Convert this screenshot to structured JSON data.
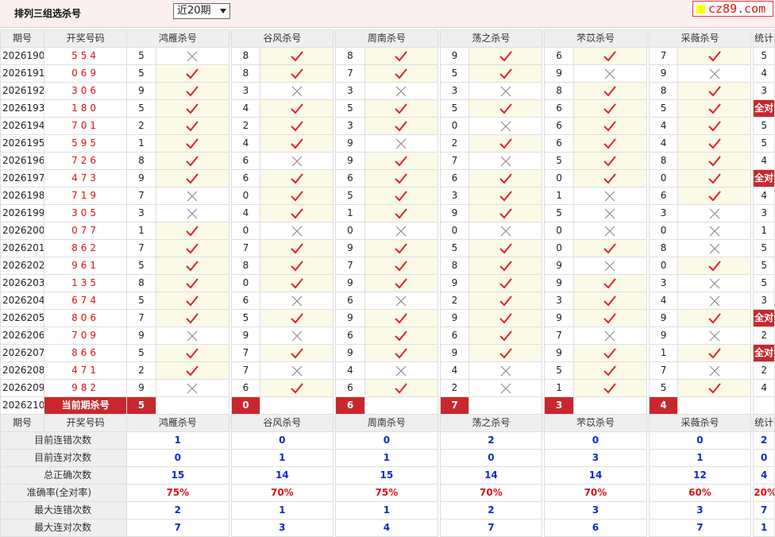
{
  "page": {
    "title": "排列三组选杀号",
    "period": "近20期",
    "site": "cz89.com"
  },
  "headers": [
    "期号",
    "开奖号码",
    "鸿雁杀号",
    "谷风杀号",
    "周南杀号",
    "荡之杀号",
    "芣苡杀号",
    "采薇杀号",
    "统计"
  ],
  "rows": [
    {
      "issue": "2026190",
      "num": "554",
      "k": [
        [
          5,
          0
        ],
        [
          8,
          1
        ],
        [
          8,
          1
        ],
        [
          9,
          1
        ],
        [
          6,
          1
        ],
        [
          7,
          1
        ]
      ],
      "cnt": "5"
    },
    {
      "issue": "2026191",
      "num": "069",
      "k": [
        [
          5,
          1
        ],
        [
          8,
          1
        ],
        [
          7,
          1
        ],
        [
          5,
          1
        ],
        [
          9,
          0
        ],
        [
          9,
          0
        ]
      ],
      "cnt": "4"
    },
    {
      "issue": "2026192",
      "num": "306",
      "k": [
        [
          9,
          1
        ],
        [
          3,
          0
        ],
        [
          3,
          0
        ],
        [
          3,
          0
        ],
        [
          8,
          1
        ],
        [
          8,
          1
        ]
      ],
      "cnt": "3"
    },
    {
      "issue": "2026193",
      "num": "180",
      "k": [
        [
          5,
          1
        ],
        [
          4,
          1
        ],
        [
          5,
          1
        ],
        [
          5,
          1
        ],
        [
          6,
          1
        ],
        [
          5,
          1
        ]
      ],
      "cnt": "全对"
    },
    {
      "issue": "2026194",
      "num": "701",
      "k": [
        [
          2,
          1
        ],
        [
          2,
          1
        ],
        [
          3,
          1
        ],
        [
          0,
          0
        ],
        [
          6,
          1
        ],
        [
          4,
          1
        ]
      ],
      "cnt": "5"
    },
    {
      "issue": "2026195",
      "num": "595",
      "k": [
        [
          1,
          1
        ],
        [
          4,
          1
        ],
        [
          9,
          0
        ],
        [
          2,
          1
        ],
        [
          6,
          1
        ],
        [
          4,
          1
        ]
      ],
      "cnt": "5"
    },
    {
      "issue": "2026196",
      "num": "726",
      "k": [
        [
          8,
          1
        ],
        [
          6,
          0
        ],
        [
          9,
          1
        ],
        [
          7,
          0
        ],
        [
          5,
          1
        ],
        [
          8,
          1
        ]
      ],
      "cnt": "4"
    },
    {
      "issue": "2026197",
      "num": "473",
      "k": [
        [
          9,
          1
        ],
        [
          6,
          1
        ],
        [
          6,
          1
        ],
        [
          6,
          1
        ],
        [
          0,
          1
        ],
        [
          0,
          1
        ]
      ],
      "cnt": "全对"
    },
    {
      "issue": "2026198",
      "num": "719",
      "k": [
        [
          7,
          0
        ],
        [
          0,
          1
        ],
        [
          5,
          1
        ],
        [
          3,
          1
        ],
        [
          1,
          0
        ],
        [
          6,
          1
        ]
      ],
      "cnt": "4"
    },
    {
      "issue": "2026199",
      "num": "305",
      "k": [
        [
          3,
          0
        ],
        [
          4,
          1
        ],
        [
          1,
          1
        ],
        [
          9,
          1
        ],
        [
          5,
          0
        ],
        [
          3,
          0
        ]
      ],
      "cnt": "3"
    },
    {
      "issue": "2026200",
      "num": "077",
      "k": [
        [
          1,
          1
        ],
        [
          0,
          0
        ],
        [
          0,
          0
        ],
        [
          0,
          0
        ],
        [
          0,
          0
        ],
        [
          0,
          0
        ]
      ],
      "cnt": "1"
    },
    {
      "issue": "2026201",
      "num": "862",
      "k": [
        [
          7,
          1
        ],
        [
          7,
          1
        ],
        [
          9,
          1
        ],
        [
          5,
          1
        ],
        [
          0,
          1
        ],
        [
          8,
          0
        ]
      ],
      "cnt": "5"
    },
    {
      "issue": "2026202",
      "num": "961",
      "k": [
        [
          5,
          1
        ],
        [
          8,
          1
        ],
        [
          7,
          1
        ],
        [
          8,
          1
        ],
        [
          9,
          0
        ],
        [
          0,
          1
        ]
      ],
      "cnt": "5"
    },
    {
      "issue": "2026203",
      "num": "135",
      "k": [
        [
          8,
          1
        ],
        [
          0,
          1
        ],
        [
          9,
          1
        ],
        [
          9,
          1
        ],
        [
          9,
          1
        ],
        [
          3,
          0
        ]
      ],
      "cnt": "5"
    },
    {
      "issue": "2026204",
      "num": "674",
      "k": [
        [
          5,
          1
        ],
        [
          6,
          0
        ],
        [
          6,
          0
        ],
        [
          2,
          1
        ],
        [
          3,
          1
        ],
        [
          4,
          0
        ]
      ],
      "cnt": "3"
    },
    {
      "issue": "2026205",
      "num": "806",
      "k": [
        [
          7,
          1
        ],
        [
          5,
          1
        ],
        [
          9,
          1
        ],
        [
          9,
          1
        ],
        [
          9,
          1
        ],
        [
          9,
          1
        ]
      ],
      "cnt": "全对"
    },
    {
      "issue": "2026206",
      "num": "709",
      "k": [
        [
          9,
          0
        ],
        [
          9,
          0
        ],
        [
          6,
          1
        ],
        [
          6,
          1
        ],
        [
          7,
          0
        ],
        [
          9,
          0
        ]
      ],
      "cnt": "2"
    },
    {
      "issue": "2026207",
      "num": "866",
      "k": [
        [
          5,
          1
        ],
        [
          7,
          1
        ],
        [
          9,
          1
        ],
        [
          9,
          1
        ],
        [
          9,
          1
        ],
        [
          1,
          1
        ]
      ],
      "cnt": "全对"
    },
    {
      "issue": "2026208",
      "num": "471",
      "k": [
        [
          2,
          1
        ],
        [
          7,
          0
        ],
        [
          4,
          0
        ],
        [
          4,
          0
        ],
        [
          5,
          1
        ],
        [
          7,
          0
        ]
      ],
      "cnt": "2"
    },
    {
      "issue": "2026209",
      "num": "982",
      "k": [
        [
          9,
          0
        ],
        [
          6,
          1
        ],
        [
          6,
          1
        ],
        [
          2,
          0
        ],
        [
          1,
          1
        ],
        [
          5,
          1
        ]
      ],
      "cnt": "4"
    }
  ],
  "current": {
    "issue": "2026210",
    "label": "当前期杀号",
    "kills": [
      "5",
      "0",
      "6",
      "7",
      "3",
      "4"
    ]
  },
  "stats": [
    {
      "label": "目前连错次数",
      "vals": [
        "1",
        "0",
        "0",
        "2",
        "0",
        "0"
      ],
      "total": "2",
      "color": "blue"
    },
    {
      "label": "目前连对次数",
      "vals": [
        "0",
        "1",
        "1",
        "0",
        "3",
        "1"
      ],
      "total": "0",
      "color": "blue"
    },
    {
      "label": "总正确次数",
      "vals": [
        "15",
        "14",
        "15",
        "14",
        "14",
        "12"
      ],
      "total": "4",
      "color": "blue"
    },
    {
      "label": "准确率(全对率)",
      "vals": [
        "75%",
        "70%",
        "75%",
        "70%",
        "70%",
        "60%"
      ],
      "total": "20%",
      "color": "red"
    },
    {
      "label": "最大连错次数",
      "vals": [
        "2",
        "1",
        "1",
        "2",
        "3",
        "3"
      ],
      "total": "7",
      "color": "blue"
    },
    {
      "label": "最大连对次数",
      "vals": [
        "7",
        "3",
        "4",
        "7",
        "6",
        "7"
      ],
      "total": "1",
      "color": "blue"
    }
  ]
}
